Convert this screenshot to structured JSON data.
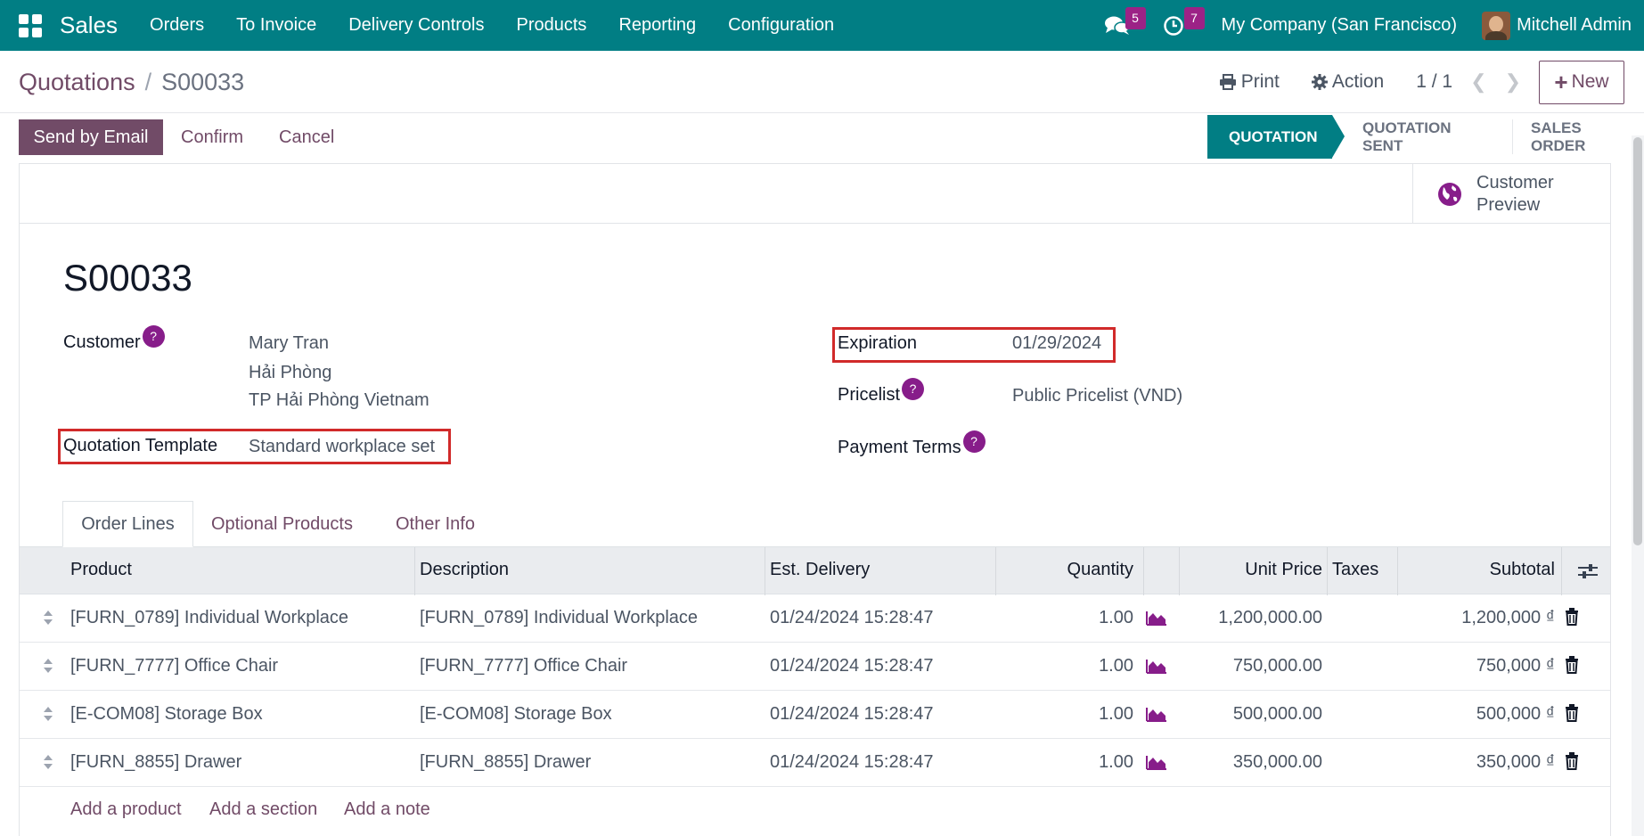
{
  "navbar": {
    "brand": "Sales",
    "menu": [
      "Orders",
      "To Invoice",
      "Delivery Controls",
      "Products",
      "Reporting",
      "Configuration"
    ],
    "messages_count": "5",
    "activities_count": "7",
    "company": "My Company (San Francisco)",
    "user": "Mitchell Admin"
  },
  "breadcrumb": {
    "parent": "Quotations",
    "separator": "/",
    "current": "S00033"
  },
  "control_panel": {
    "print": "Print",
    "action": "Action",
    "pager": "1 / 1",
    "new": "New"
  },
  "statusbar": {
    "send_email": "Send by Email",
    "confirm": "Confirm",
    "cancel": "Cancel",
    "stages": [
      "QUOTATION",
      "QUOTATION SENT",
      "SALES ORDER"
    ],
    "active_stage": "QUOTATION"
  },
  "smart_button": {
    "label": "Customer Preview"
  },
  "form": {
    "name": "S00033",
    "customer_label": "Customer",
    "customer_lines": [
      "Mary Tran",
      "Hải Phòng",
      "TP Hải Phòng Vietnam"
    ],
    "template_label": "Quotation Template",
    "template_value": "Standard workplace set",
    "expiration_label": "Expiration",
    "expiration_value": "01/29/2024",
    "pricelist_label": "Pricelist",
    "pricelist_value": "Public Pricelist (VND)",
    "payment_terms_label": "Payment Terms",
    "help": "?"
  },
  "tabs": [
    "Order Lines",
    "Optional Products",
    "Other Info"
  ],
  "table": {
    "headers": {
      "product": "Product",
      "description": "Description",
      "delivery": "Est. Delivery",
      "quantity": "Quantity",
      "unit_price": "Unit Price",
      "taxes": "Taxes",
      "subtotal": "Subtotal"
    },
    "rows": [
      {
        "product": "[FURN_0789] Individual Workplace",
        "description": "[FURN_0789] Individual Workplace",
        "delivery": "01/24/2024 15:28:47",
        "quantity": "1.00",
        "unit_price": "1,200,000.00",
        "subtotal": "1,200,000 ₫"
      },
      {
        "product": "[FURN_7777] Office Chair",
        "description": "[FURN_7777] Office Chair",
        "delivery": "01/24/2024 15:28:47",
        "quantity": "1.00",
        "unit_price": "750,000.00",
        "subtotal": "750,000 ₫"
      },
      {
        "product": "[E-COM08] Storage Box",
        "description": "[E-COM08] Storage Box",
        "delivery": "01/24/2024 15:28:47",
        "quantity": "1.00",
        "unit_price": "500,000.00",
        "subtotal": "500,000 ₫"
      },
      {
        "product": "[FURN_8855] Drawer",
        "description": "[FURN_8855] Drawer",
        "delivery": "01/24/2024 15:28:47",
        "quantity": "1.00",
        "unit_price": "350,000.00",
        "subtotal": "350,000 ₫"
      }
    ],
    "add_product": "Add a product",
    "add_section": "Add a section",
    "add_note": "Add a note"
  },
  "colors": {
    "navbar": "#017e84",
    "primary": "#714b67",
    "highlight": "#d12a2a"
  }
}
